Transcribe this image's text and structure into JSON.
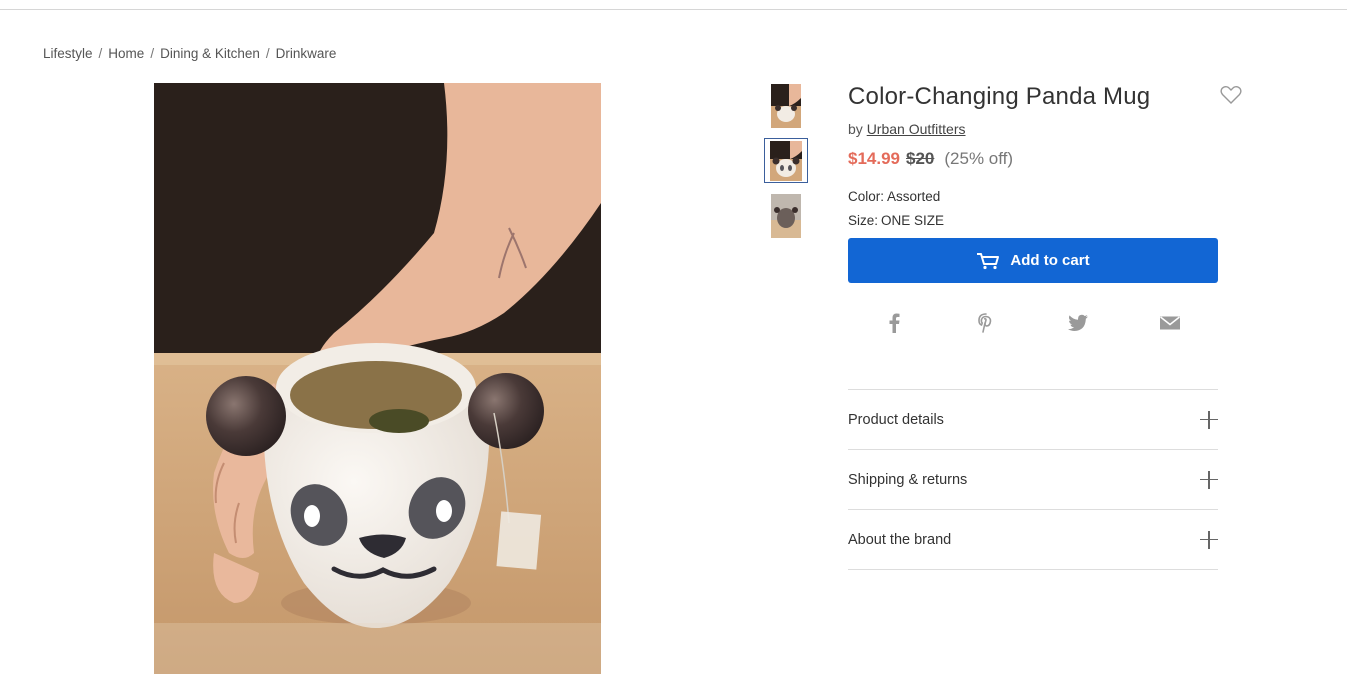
{
  "breadcrumb": [
    "Lifestyle",
    "Home",
    "Dining & Kitchen",
    "Drinkware"
  ],
  "breadcrumb_separator": "/",
  "product": {
    "title": "Color-Changing Panda Mug",
    "by_prefix": "by",
    "brand": "Urban Outfitters",
    "price_now": "$14.99",
    "price_was": "$20",
    "discount": "(25% off)",
    "color_label": "Color:",
    "color_value": "Assorted",
    "size_label": "Size:",
    "size_value": "ONE SIZE",
    "add_to_cart": "Add to cart"
  },
  "gallery": {
    "thumbnail_count": 3,
    "selected_thumbnail": 2
  },
  "share": [
    "facebook-icon",
    "pinterest-icon",
    "twitter-icon",
    "email-icon"
  ],
  "accordion": [
    {
      "label": "Product details"
    },
    {
      "label": "Shipping & returns"
    },
    {
      "label": "About the brand"
    }
  ],
  "colors": {
    "accent": "#1266d4",
    "sale_price": "#e46b5a",
    "thumb_selected": "#3b5f9c"
  }
}
